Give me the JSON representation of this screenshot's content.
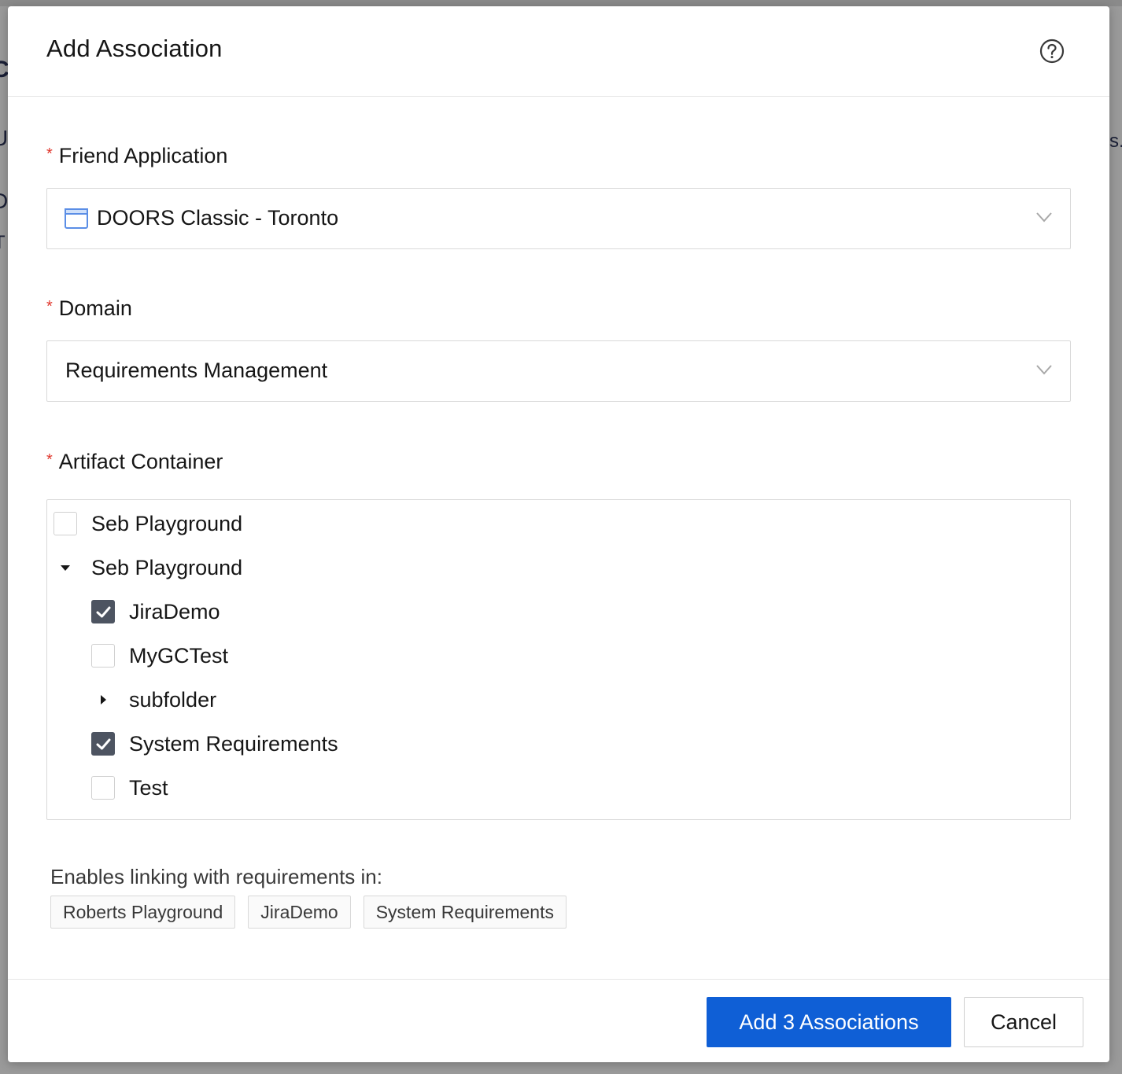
{
  "background": {
    "fragments": [
      "C",
      "U",
      "D",
      "T",
      "s."
    ]
  },
  "dialog": {
    "title": "Add Association",
    "help_icon": "question-circle-icon"
  },
  "friend_application": {
    "label": "Friend Application",
    "required_marker": "*",
    "value": "DOORS Classic - Toronto",
    "icon": "application-window-icon"
  },
  "domain": {
    "label": "Domain",
    "required_marker": "*",
    "value": "Requirements Management"
  },
  "artifact_container": {
    "label": "Artifact Container",
    "required_marker": "*",
    "tree": [
      {
        "label": "Seb Playground",
        "type": "checkbox",
        "checked": false,
        "level": 0
      },
      {
        "label": "Seb Playground",
        "type": "expanded",
        "level": 0
      },
      {
        "label": "JiraDemo",
        "type": "checkbox",
        "checked": true,
        "level": 1
      },
      {
        "label": "MyGCTest",
        "type": "checkbox",
        "checked": false,
        "level": 1
      },
      {
        "label": "subfolder",
        "type": "collapsed",
        "level": 1
      },
      {
        "label": "System Requirements",
        "type": "checkbox",
        "checked": true,
        "level": 1
      },
      {
        "label": "Test",
        "type": "checkbox",
        "checked": false,
        "level": 1
      }
    ]
  },
  "linking": {
    "label": "Enables linking with requirements in:",
    "tags": [
      "Roberts Playground",
      "JiraDemo",
      "System Requirements"
    ]
  },
  "footer": {
    "primary_label": "Add 3 Associations",
    "cancel_label": "Cancel"
  },
  "colors": {
    "primary": "#0f5fd6",
    "required": "#e0362c",
    "checkbox_checked": "#4d5461"
  }
}
